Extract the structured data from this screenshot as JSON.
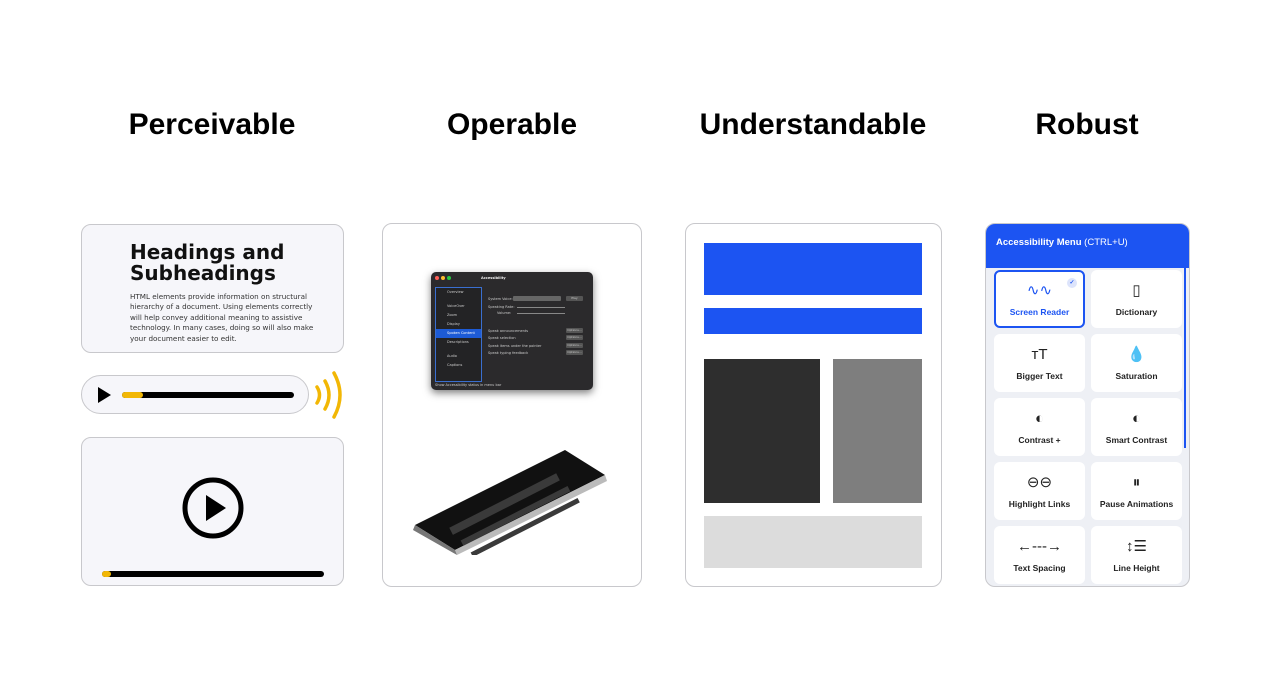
{
  "headings": [
    "Perceivable",
    "Operable",
    "Understandable",
    "Robust"
  ],
  "perceivable": {
    "title": "Headings and Subheadings",
    "body": "HTML elements provide information on structural hierarchy of a document. Using elements correctly will help convey additional meaning to assistive technology. In many cases, doing so will also make your document easier to edit.",
    "audio_progress": 0.12,
    "video_progress": 0.04,
    "accent": "#f2b705"
  },
  "operable": {
    "window_title": "Accessibility",
    "sidebar": [
      "Overview",
      "VoiceOver",
      "Zoom",
      "Display",
      "Spoken Content",
      "Descriptions",
      "Audio",
      "Captions"
    ],
    "selected": "Spoken Content",
    "system_voice_label": "System Voice:",
    "play_label": "Play",
    "speaking_rate_label": "Speaking Rate:",
    "volume_label": "Volume:",
    "options": [
      "Speak announcements",
      "Speak selection",
      "Speak items under the pointer",
      "Speak typing feedback"
    ],
    "options_button": "Options...",
    "footer": "Show Accessibility status in menu bar"
  },
  "robust": {
    "menu_title": "Accessibility Menu",
    "shortcut": "(CTRL+U)",
    "accent": "#1c54f2",
    "tiles": [
      {
        "label": "Screen Reader",
        "icon": "∿∿",
        "active": true
      },
      {
        "label": "Dictionary",
        "icon": "▯"
      },
      {
        "label": "Bigger Text",
        "icon": "тT"
      },
      {
        "label": "Saturation",
        "icon": "💧"
      },
      {
        "label": "Contrast +",
        "icon": "◐"
      },
      {
        "label": "Smart Contrast",
        "icon": "◐"
      },
      {
        "label": "Highlight Links",
        "icon": "⊖⊖"
      },
      {
        "label": "Pause Animations",
        "icon": "⏸"
      },
      {
        "label": "Text Spacing",
        "icon": "←---→"
      },
      {
        "label": "Line Height",
        "icon": "↕☰"
      }
    ]
  }
}
